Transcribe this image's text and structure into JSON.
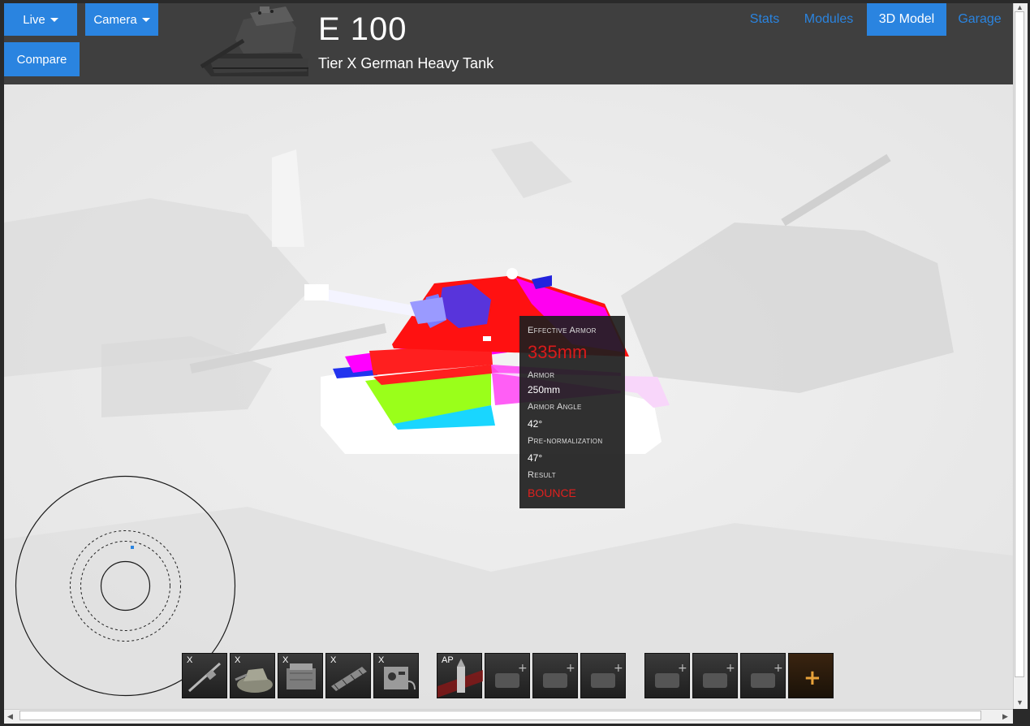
{
  "toolbar": {
    "live_label": "Live",
    "camera_label": "Camera",
    "compare_label": "Compare"
  },
  "tank": {
    "name": "E 100",
    "subtitle": "Tier X German Heavy Tank"
  },
  "nav": {
    "stats": "Stats",
    "modules": "Modules",
    "model": "3D Model",
    "garage": "Garage",
    "active": "3D Model"
  },
  "tooltip": {
    "effective_armor_label": "Effective Armor",
    "effective_armor_value": "335mm",
    "armor_label": "Armor",
    "armor_value": "250mm",
    "angle_label": "Armor Angle",
    "angle_value": "42°",
    "prenorm_label": "Pre-normalization",
    "prenorm_value": "47°",
    "result_label": "Result",
    "result_value": "BOUNCE"
  },
  "modules": [
    {
      "tag": "X",
      "icon": "gun-icon"
    },
    {
      "tag": "X",
      "icon": "turret-icon"
    },
    {
      "tag": "X",
      "icon": "engine-icon"
    },
    {
      "tag": "X",
      "icon": "tracks-icon"
    },
    {
      "tag": "X",
      "icon": "radio-icon"
    }
  ],
  "ammo": [
    {
      "tag": "AP",
      "icon": "ap-shell-icon"
    },
    {
      "tag": "",
      "icon": "empty-consumable-icon"
    },
    {
      "tag": "",
      "icon": "empty-consumable-icon"
    },
    {
      "tag": "",
      "icon": "empty-consumable-icon"
    }
  ],
  "equipment": [
    {
      "icon": "empty-equipment-icon"
    },
    {
      "icon": "empty-equipment-icon"
    },
    {
      "icon": "empty-equipment-icon"
    },
    {
      "icon": "add-equipment-icon"
    }
  ],
  "colors": {
    "accent": "#2a84e0",
    "bar": "#3f3f3f",
    "result_bounce": "#e0201e"
  }
}
